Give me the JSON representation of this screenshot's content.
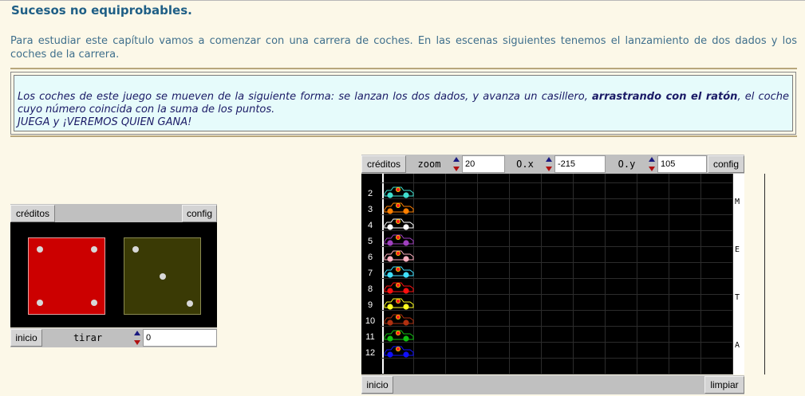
{
  "page": {
    "title": "Sucesos no equiprobables.",
    "intro": "Para estudiar este capítulo vamos a comenzar con una carrera de coches. En las escenas siguientes tenemos el lanzamiento de dos dados y los coches de la carrera.",
    "note_part1": "Los coches de este juego se mueven de la siguiente forma: se lanzan los dos dados, y avanza un casillero, ",
    "note_bold": "arrastrando con el ratón",
    "note_part2": ", el coche cuyo número coincida con la suma de los puntos.",
    "note_line2": "JUEGA y ¡VEREMOS QUIEN GANA!"
  },
  "dice_applet": {
    "creditos": "créditos",
    "config": "config",
    "inicio": "inicio",
    "tirar": "tirar",
    "value": "0",
    "die1": {
      "color": "#cc0000",
      "pips": 4
    },
    "die2": {
      "color": "#3a3a05",
      "pips": 3
    }
  },
  "race_applet": {
    "creditos": "créditos",
    "zoom_label": "zoom",
    "zoom_value": "20",
    "ox_label": "O.x",
    "ox_value": "-215",
    "oy_label": "O.y",
    "oy_value": "105",
    "config": "config",
    "inicio": "inicio",
    "limpiar": "limpiar",
    "finish_letters": [
      "M",
      "E",
      "T",
      "A"
    ],
    "cars": [
      {
        "number": "2",
        "color": "#40e0d0"
      },
      {
        "number": "3",
        "color": "#ff7f00"
      },
      {
        "number": "4",
        "color": "#ffffff"
      },
      {
        "number": "5",
        "color": "#a040c0"
      },
      {
        "number": "6",
        "color": "#ffb0c0"
      },
      {
        "number": "7",
        "color": "#40e0ff"
      },
      {
        "number": "8",
        "color": "#ff1010"
      },
      {
        "number": "9",
        "color": "#ffff20"
      },
      {
        "number": "10",
        "color": "#b03010"
      },
      {
        "number": "11",
        "color": "#10c010"
      },
      {
        "number": "12",
        "color": "#1010ff"
      }
    ]
  }
}
